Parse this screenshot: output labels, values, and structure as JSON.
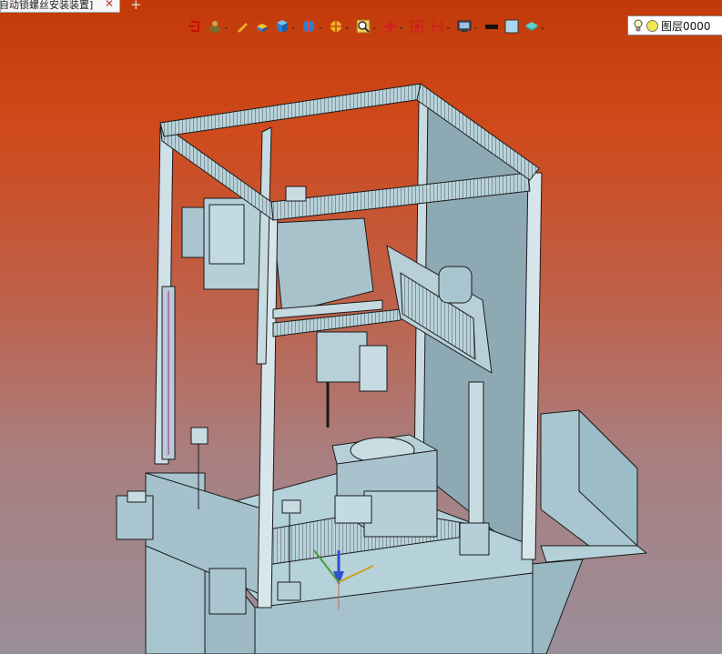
{
  "document_tab": {
    "title": "自动锁螺丝安装装置]",
    "close": "✕",
    "new_tab": "+"
  },
  "toolbar": {
    "items": [
      {
        "name": "exit-sketch-icon",
        "dropdown": false
      },
      {
        "name": "eraser-icon",
        "dropdown": true
      },
      {
        "name": "pencil-icon",
        "dropdown": false
      },
      {
        "name": "box-tool-icon",
        "dropdown": false
      },
      {
        "name": "cube-view-icon",
        "dropdown": true
      },
      {
        "name": "section-view-icon",
        "dropdown": true
      },
      {
        "name": "render-mode-icon",
        "dropdown": true
      },
      {
        "name": "zoom-icon",
        "dropdown": true
      },
      {
        "name": "move-view-icon",
        "dropdown": true
      },
      {
        "name": "rotate-view-icon",
        "dropdown": false
      },
      {
        "name": "dimension-icon",
        "dropdown": true
      },
      {
        "name": "display-icon",
        "dropdown": true
      },
      {
        "name": "line-color-icon",
        "dropdown": false
      },
      {
        "name": "face-color-icon",
        "dropdown": false
      },
      {
        "name": "layer-manager-icon",
        "dropdown": true
      }
    ],
    "dropdown_arrow": "⌄"
  },
  "layer": {
    "current": "图层0000"
  },
  "colors": {
    "bg_top": "#c23a08",
    "bg_bottom": "#9a8e99",
    "part_fill": "#a9c9d3",
    "part_dark": "#8aaab6",
    "edge": "#1a1a1a",
    "accent_purple": "#b070c0"
  }
}
